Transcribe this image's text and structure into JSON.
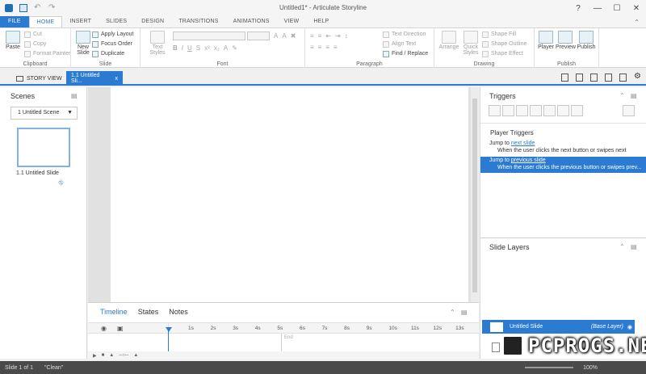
{
  "window": {
    "title": "Untitled1* - Articulate Storyline",
    "controls": [
      "?",
      "—",
      "☐",
      "✕"
    ]
  },
  "ribbon": {
    "tabs": [
      "FILE",
      "HOME",
      "INSERT",
      "SLIDES",
      "DESIGN",
      "TRANSITIONS",
      "ANIMATIONS",
      "VIEW",
      "HELP"
    ],
    "active_tab": "HOME",
    "clipboard": {
      "label": "Clipboard",
      "paste": "Paste",
      "cut": "Cut",
      "copy": "Copy",
      "format_painter": "Format Painter"
    },
    "slide": {
      "label": "Slide",
      "new_slide": "New Slide",
      "apply_layout": "Apply Layout",
      "focus_order": "Focus Order",
      "duplicate": "Duplicate"
    },
    "font": {
      "label": "Font",
      "text_styles": "Text Styles"
    },
    "paragraph": {
      "label": "Paragraph",
      "text_direction": "Text Direction",
      "align_text": "Align Text",
      "find_replace": "Find / Replace"
    },
    "drawing": {
      "label": "Drawing",
      "arrange": "Arrange",
      "quick_styles": "Quick Styles",
      "shape_fill": "Shape Fill",
      "shape_outline": "Shape Outline",
      "shape_effect": "Shape Effect"
    },
    "publish": {
      "label": "Publish",
      "player": "Player",
      "preview": "Preview",
      "publish": "Publish"
    }
  },
  "doc_tabs": {
    "story_view": "STORY VIEW",
    "slide_tab": "1.1 Untitled Sli...",
    "close": "x"
  },
  "scenes": {
    "title": "Scenes",
    "selected_scene": "1 Untitled Scene",
    "thumbnail_label": "1.1 Untitled Slide"
  },
  "timeline": {
    "tabs": [
      "Timeline",
      "States",
      "Notes"
    ],
    "active_tab": "Timeline",
    "ticks": [
      "1s",
      "2s",
      "3s",
      "4s",
      "5s",
      "6s",
      "7s",
      "8s",
      "9s",
      "10s",
      "11s",
      "12s",
      "13s"
    ],
    "end_label": "End"
  },
  "triggers": {
    "title": "Triggers",
    "section": "Player Triggers",
    "items": [
      {
        "action": "Jump to ",
        "target": "next slide",
        "condition": "When the user clicks the next button or swipes next"
      },
      {
        "action": "Jump to ",
        "target": "previous slide",
        "condition": "When the user clicks the previous button or swipes prev..."
      }
    ]
  },
  "slide_layers": {
    "title": "Slide Layers",
    "base_name": "Untitled Slide",
    "base_tag": "(Base Layer)"
  },
  "status": {
    "slide": "Slide 1 of 1",
    "state": "\"Clean\"",
    "zoom": "100%"
  },
  "watermark": "PCPROGS.NET",
  "colors": {
    "accent": "#2b7bd3",
    "status_bar": "#4a4a4a"
  }
}
